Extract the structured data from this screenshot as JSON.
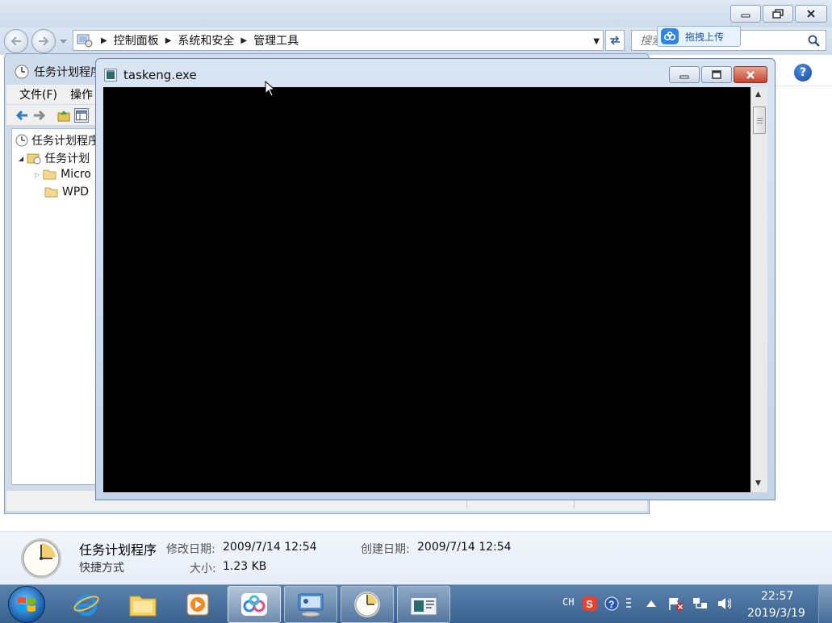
{
  "explorer": {
    "breadcrumbs": [
      "控制面板",
      "系统和安全",
      "管理工具"
    ],
    "search_placeholder": "搜索",
    "upload_badge": "拖拽上传",
    "help": "?",
    "details": {
      "name": "任务计划程序",
      "type": "快捷方式",
      "modified_label": "修改日期:",
      "modified_value": "2009/7/14 12:54",
      "created_label": "创建日期:",
      "created_value": "2009/7/14 12:54",
      "size_label": "大小:",
      "size_value": "1.23 KB"
    }
  },
  "scheduler": {
    "title": "任务计划程序",
    "menu": [
      "文件(F)",
      "操作"
    ],
    "tree": {
      "root": "任务计划程序",
      "library": "任务计划",
      "children": [
        "Micro",
        "WPD"
      ]
    }
  },
  "console": {
    "title": "taskeng.exe"
  },
  "taskbar": {
    "ime": "CH",
    "time": "22:57",
    "date": "2019/3/19"
  },
  "colors": {
    "console_bg": "#000000",
    "taskbar": "#4a729e",
    "close_red": "#c4422b"
  }
}
